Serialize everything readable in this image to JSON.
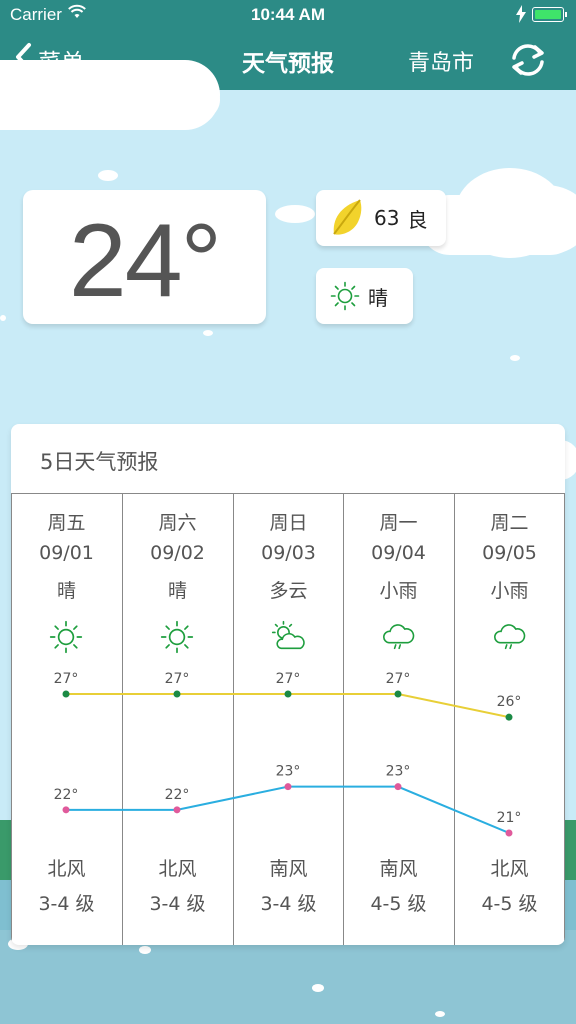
{
  "status_bar": {
    "carrier": "Carrier",
    "time": "10:44 AM"
  },
  "nav": {
    "back_label": "菜单",
    "title": "天气预报",
    "city": "青岛市"
  },
  "current": {
    "temperature": "24°",
    "aqi_value": "63",
    "aqi_level": "良",
    "condition": "晴"
  },
  "forecast": {
    "title": "5日天气预报",
    "days": [
      {
        "weekday": "周五",
        "date": "09/01",
        "condition": "晴",
        "icon": "sun-icon",
        "wind_dir": "北风",
        "wind_level": "3-4 级"
      },
      {
        "weekday": "周六",
        "date": "09/02",
        "condition": "晴",
        "icon": "sun-icon",
        "wind_dir": "北风",
        "wind_level": "3-4 级"
      },
      {
        "weekday": "周日",
        "date": "09/03",
        "condition": "多云",
        "icon": "partly-cloudy-icon",
        "wind_dir": "南风",
        "wind_level": "3-4 级"
      },
      {
        "weekday": "周一",
        "date": "09/04",
        "condition": "小雨",
        "icon": "light-rain-icon",
        "wind_dir": "南风",
        "wind_level": "4-5 级"
      },
      {
        "weekday": "周二",
        "date": "09/05",
        "condition": "小雨",
        "icon": "light-rain-icon",
        "wind_dir": "北风",
        "wind_level": "4-5 级"
      }
    ]
  },
  "chart_data": {
    "type": "line",
    "categories": [
      "09/01",
      "09/02",
      "09/03",
      "09/04",
      "09/05"
    ],
    "series": [
      {
        "values": [
          27,
          27,
          27,
          27,
          26
        ],
        "color": "#e8cf37",
        "point_color": "#1b8a45"
      },
      {
        "values": [
          22,
          22,
          23,
          23,
          21
        ],
        "color": "#2aaee0",
        "point_color": "#e05a9b"
      }
    ]
  },
  "colors": {
    "nav_bg": "#2c8b86",
    "sky": "#c9ebf7",
    "icon_green": "#1e9e3e"
  }
}
